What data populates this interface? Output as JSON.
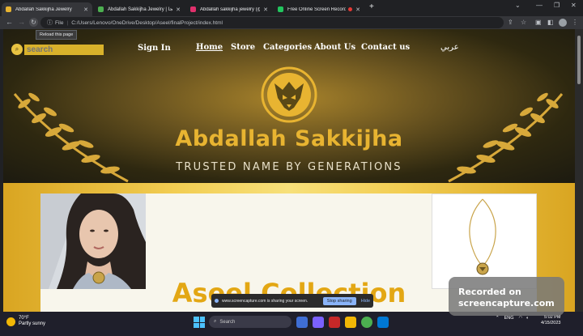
{
  "browser": {
    "tabs": [
      {
        "title": "Abdallah Sakkijha Jewelry",
        "color": "#e8b431",
        "active": true
      },
      {
        "title": "Abdallah Sakkijha Jewelry | عبدالله سقيجا",
        "color": "#4caf50",
        "active": false
      },
      {
        "title": "Abdallah sakkijha jewelry (@abd...",
        "color": "#e1306c",
        "active": false
      },
      {
        "title": "Free Online Screen Recorder",
        "color": "#22c55e",
        "active": false
      }
    ],
    "url_label": "File",
    "url": "C:/Users/Lenovo/OneDrive/Desktop/Aseel/finalProject/index.html",
    "reload_tooltip": "Reload this page"
  },
  "site": {
    "search_placeholder": "search",
    "nav": {
      "signin": "Sign In",
      "home": "Home",
      "store": "Store",
      "categories": "Categories",
      "about": "About Us",
      "contact": "Contact us",
      "lang": "عربي"
    },
    "brand": "Abdallah Sakkijha",
    "tagline": "TRUSTED NAME BY GENERATIONS",
    "collection_title": "Aseel Collection"
  },
  "overlays": {
    "share_text": "www.screencapture.com is sharing your screen.",
    "stop_label": "Stop sharing",
    "hide_label": "Hide",
    "recorded_line1": "Recorded on",
    "recorded_line2": "screencapture.com"
  },
  "taskbar": {
    "temp": "70°F",
    "weather": "Partly sunny",
    "search_label": "Search",
    "lang": "ENG",
    "time": "5:02 PM",
    "date": "4/15/2023"
  },
  "colors": {
    "gold": "#e8b431",
    "brand_gold": "#e3a714",
    "tab_active": "#35363a"
  }
}
